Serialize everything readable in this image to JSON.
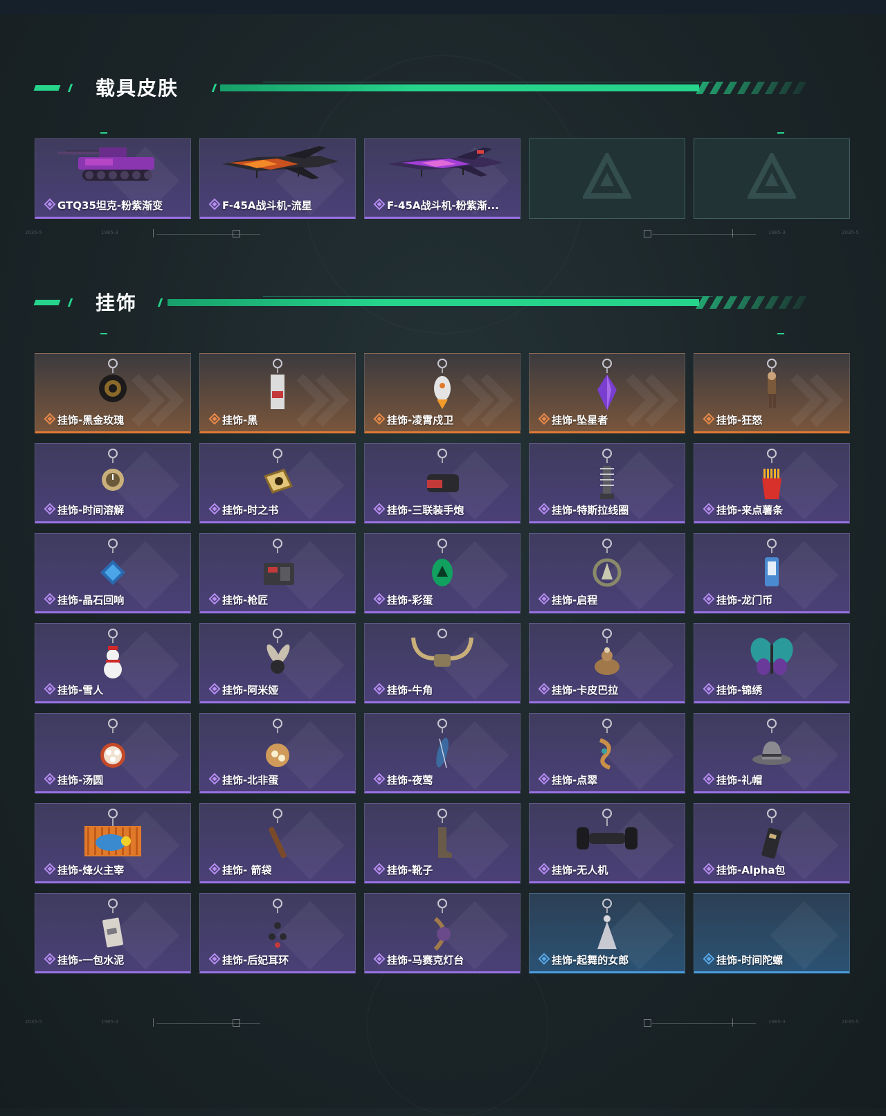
{
  "vehicle_section": {
    "title": "载具皮肤",
    "items": [
      {
        "name": "GTQ35坦克-粉紫渐变",
        "rarity": "purple",
        "icon": "tank"
      },
      {
        "name": "F-45A战斗机-流星",
        "rarity": "purple",
        "icon": "jet-flame"
      },
      {
        "name": "F-45A战斗机-粉紫渐...",
        "rarity": "purple",
        "icon": "jet-purple"
      },
      {
        "name": "",
        "rarity": "empty",
        "icon": "logo"
      },
      {
        "name": "",
        "rarity": "empty",
        "icon": "logo"
      }
    ]
  },
  "charm_section": {
    "title": "挂饰",
    "items": [
      {
        "name": "挂饰-黑金玫瑰",
        "rarity": "orange",
        "icon": "rose-charm"
      },
      {
        "name": "挂饰-黑",
        "rarity": "orange",
        "icon": "tag-charm"
      },
      {
        "name": "挂饰-凌霄戍卫",
        "rarity": "orange",
        "icon": "rocket-charm"
      },
      {
        "name": "挂饰-坠星者",
        "rarity": "orange",
        "icon": "crystal-charm"
      },
      {
        "name": "挂饰-狂怒",
        "rarity": "orange",
        "icon": "figure-charm"
      },
      {
        "name": "挂饰-时间溶解",
        "rarity": "purple",
        "icon": "clock-charm"
      },
      {
        "name": "挂饰-时之书",
        "rarity": "purple",
        "icon": "book-charm"
      },
      {
        "name": "挂饰-三联装手炮",
        "rarity": "purple",
        "icon": "cannon-charm"
      },
      {
        "name": "挂饰-特斯拉线圈",
        "rarity": "purple",
        "icon": "coil-charm"
      },
      {
        "name": "挂饰-来点薯条",
        "rarity": "purple",
        "icon": "fries-charm"
      },
      {
        "name": "挂饰-晶石回响",
        "rarity": "purple",
        "icon": "gem-charm"
      },
      {
        "name": "挂饰-枪匠",
        "rarity": "purple",
        "icon": "toolbox-charm"
      },
      {
        "name": "挂饰-彩蛋",
        "rarity": "purple",
        "icon": "egg-charm"
      },
      {
        "name": "挂饰-启程",
        "rarity": "purple",
        "icon": "compass-charm"
      },
      {
        "name": "挂饰-龙门币",
        "rarity": "purple",
        "icon": "coin-charm"
      },
      {
        "name": "挂饰-雪人",
        "rarity": "purple",
        "icon": "snowman-charm"
      },
      {
        "name": "挂饰-阿米娅",
        "rarity": "purple",
        "icon": "bunny-charm"
      },
      {
        "name": "挂饰-牛角",
        "rarity": "purple",
        "icon": "horns-charm"
      },
      {
        "name": "挂饰-卡皮巴拉",
        "rarity": "purple",
        "icon": "capybara-charm"
      },
      {
        "name": "挂饰-锦绣",
        "rarity": "purple",
        "icon": "butterfly-charm"
      },
      {
        "name": "挂饰-汤圆",
        "rarity": "purple",
        "icon": "dumpling-charm"
      },
      {
        "name": "挂饰-北非蛋",
        "rarity": "purple",
        "icon": "pan-charm"
      },
      {
        "name": "挂饰-夜莺",
        "rarity": "purple",
        "icon": "feather-charm"
      },
      {
        "name": "挂饰-点翠",
        "rarity": "purple",
        "icon": "ornament-charm"
      },
      {
        "name": "挂饰-礼帽",
        "rarity": "purple",
        "icon": "hat-charm"
      },
      {
        "name": "挂饰-烽火主宰",
        "rarity": "purple",
        "icon": "container-charm"
      },
      {
        "name": "挂饰- 箭袋",
        "rarity": "purple",
        "icon": "quiver-charm"
      },
      {
        "name": "挂饰-靴子",
        "rarity": "purple",
        "icon": "boot-charm"
      },
      {
        "name": "挂饰-无人机",
        "rarity": "purple",
        "icon": "drone-charm"
      },
      {
        "name": "挂饰-Alpha包",
        "rarity": "purple",
        "icon": "bag-charm"
      },
      {
        "name": "挂饰-一包水泥",
        "rarity": "purple",
        "icon": "cement-charm"
      },
      {
        "name": "挂饰-后妃耳环",
        "rarity": "purple",
        "icon": "earring-charm"
      },
      {
        "name": "挂饰-马赛克灯台",
        "rarity": "purple",
        "icon": "lamp-charm"
      },
      {
        "name": "挂饰-起舞的女郎",
        "rarity": "blue",
        "icon": "dancer-charm"
      },
      {
        "name": "挂饰-时间陀螺",
        "rarity": "blue",
        "icon": "top-charm"
      }
    ]
  },
  "colors": {
    "accent_green": "#26d48c",
    "purple_rarity": "#9a72e6",
    "orange_rarity": "#e07a38",
    "blue_rarity": "#4a9ee0"
  }
}
